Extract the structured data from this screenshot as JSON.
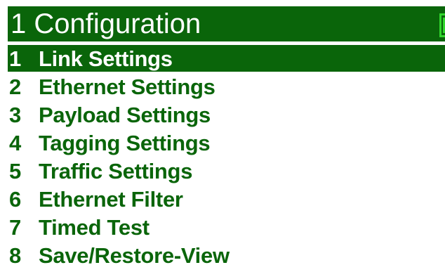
{
  "header": {
    "title": "1 Configuration",
    "battery_icon": "battery-icon",
    "battery_color": "#31d62d"
  },
  "colors": {
    "accent": "#0a650a",
    "background": "#ffffff",
    "selected_text": "#ffffff"
  },
  "menu": {
    "selected_index": 0,
    "items": [
      {
        "number": "1",
        "label": "Link Settings"
      },
      {
        "number": "2",
        "label": "Ethernet Settings"
      },
      {
        "number": "3",
        "label": "Payload Settings"
      },
      {
        "number": "4",
        "label": "Tagging Settings"
      },
      {
        "number": "5",
        "label": "Traffic Settings"
      },
      {
        "number": "6",
        "label": "Ethernet Filter"
      },
      {
        "number": "7",
        "label": "Timed Test"
      },
      {
        "number": "8",
        "label": "Save/Restore-View"
      }
    ]
  }
}
